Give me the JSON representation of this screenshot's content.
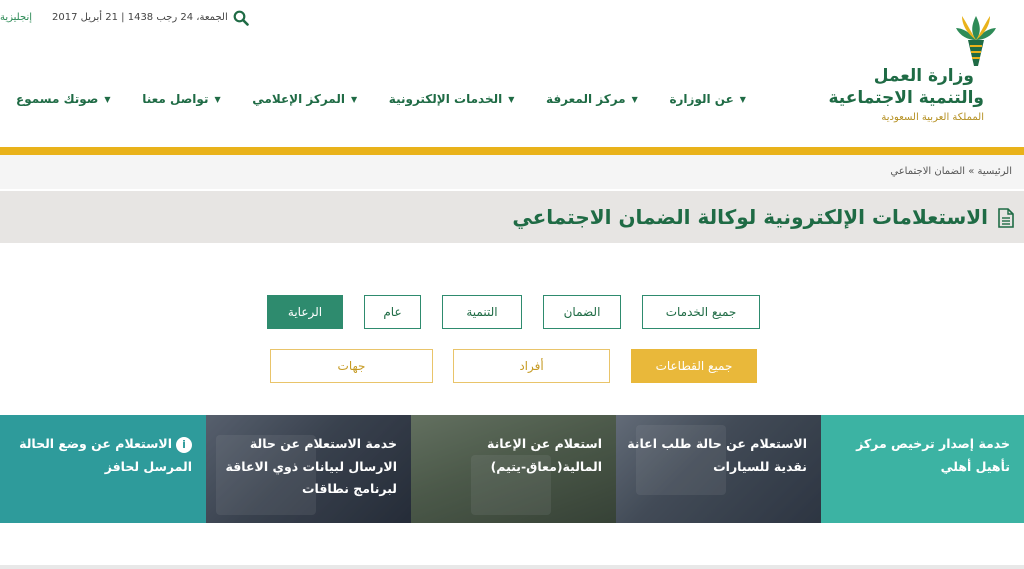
{
  "topbar": {
    "language_link": "إنجليزية",
    "date": "الجمعة، 24 رجب 1438 | 21 أبريل 2017"
  },
  "logo": {
    "line1": "وزارة العمل",
    "line2": "والتنمية الاجتماعية",
    "line3": "المملكة العربية السعودية"
  },
  "nav": {
    "items": [
      {
        "label": "عن الوزارة"
      },
      {
        "label": "مركز المعرفة"
      },
      {
        "label": "الخدمات الإلكترونية"
      },
      {
        "label": "المركز الإعلامي"
      },
      {
        "label": "تواصل معنا"
      },
      {
        "label": "صوتك مسموع"
      }
    ]
  },
  "breadcrumb": {
    "home": "الرئيسية",
    "separator": "»",
    "current": "الضمان الاجتماعي"
  },
  "page_title": "الاستعلامات الإلكترونية لوكالة الضمان الاجتماعي",
  "filters": {
    "category": [
      {
        "label": "جميع الخدمات",
        "active": false
      },
      {
        "label": "الضمان",
        "active": false
      },
      {
        "label": "التنمية",
        "active": false
      },
      {
        "label": "عام",
        "active": false
      },
      {
        "label": "الرعاية",
        "active": true
      }
    ],
    "sector": [
      {
        "label": "جميع القطاعات",
        "active": true
      },
      {
        "label": "أفراد",
        "active": false
      },
      {
        "label": "جهات",
        "active": false
      }
    ]
  },
  "tiles": [
    {
      "text": "خدمة إصدار ترخيص مركز تأهيل أهلي"
    },
    {
      "text": "الاستعلام عن حالة طلب اعانة نقدية للسيارات"
    },
    {
      "text": "استعلام عن الإعانة المالية(معاق-يتيم)"
    },
    {
      "text": "خدمة الاستعلام عن حالة الارسال لبيانات ذوي الاعاقة لبرنامج نطاقات"
    },
    {
      "text": "الاستعلام عن وضع الحالة المرسل لحافز"
    }
  ],
  "colors": {
    "brand_green": "#1f6b45",
    "accent_gold": "#e9b21a",
    "teal": "#3cb3a3"
  }
}
